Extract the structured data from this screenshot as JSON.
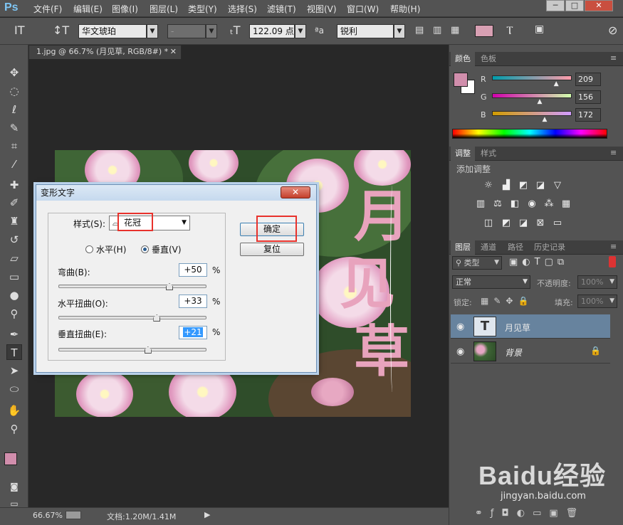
{
  "menubar": {
    "logo": "Ps",
    "items": [
      "文件(F)",
      "编辑(E)",
      "图像(I)",
      "图层(L)",
      "类型(Y)",
      "选择(S)",
      "滤镜(T)",
      "视图(V)",
      "窗口(W)",
      "帮助(H)"
    ],
    "window_buttons": [
      "─",
      "□",
      "✕"
    ]
  },
  "options": {
    "font_family": "华文琥珀",
    "font_style": "-",
    "font_size": "122.09 点",
    "antialias": "锐利",
    "text_color": "#d8a0b3",
    "aa_label": "ªa"
  },
  "document": {
    "tab_title": "1.jpg @ 66.7% (月见草, RGB/8#) *",
    "warped_text": [
      "月",
      "见",
      "草"
    ]
  },
  "dialog": {
    "title": "变形文字",
    "style_label": "样式(S):",
    "style_value": "花冠",
    "orientation": {
      "horizontal": "水平(H)",
      "vertical": "垂直(V)",
      "selected": "vertical"
    },
    "bend_label": "弯曲(B):",
    "bend_value": "+50",
    "hdist_label": "水平扭曲(O):",
    "hdist_value": "+33",
    "vdist_label": "垂直扭曲(E):",
    "vdist_value": "+21",
    "percent": "%",
    "ok_label": "确定",
    "reset_label": "复位",
    "close_label": "✕"
  },
  "color_panel": {
    "tabs": [
      "颜色",
      "色板"
    ],
    "foreground": "#d18eac",
    "channels": [
      {
        "label": "R",
        "value": "209"
      },
      {
        "label": "G",
        "value": "156"
      },
      {
        "label": "B",
        "value": "172"
      }
    ]
  },
  "adjust_panel": {
    "tabs": [
      "调整",
      "样式"
    ],
    "title": "添加调整"
  },
  "layers_panel": {
    "tabs": [
      "图层",
      "通道",
      "路径",
      "历史记录"
    ],
    "filter_kind": "类型",
    "blend_mode": "正常",
    "opacity_label": "不透明度:",
    "opacity_value": "100%",
    "lock_label": "锁定:",
    "fill_label": "填充:",
    "fill_value": "100%",
    "layers": [
      {
        "name": "月见草",
        "type": "text",
        "selected": true
      },
      {
        "name": "背景",
        "type": "image",
        "locked": true
      }
    ]
  },
  "status": {
    "zoom": "66.67%",
    "doc_info": "文档:1.20M/1.41M"
  },
  "watermark": {
    "logo": "Baidu经验",
    "url": "jingyan.baidu.com"
  }
}
